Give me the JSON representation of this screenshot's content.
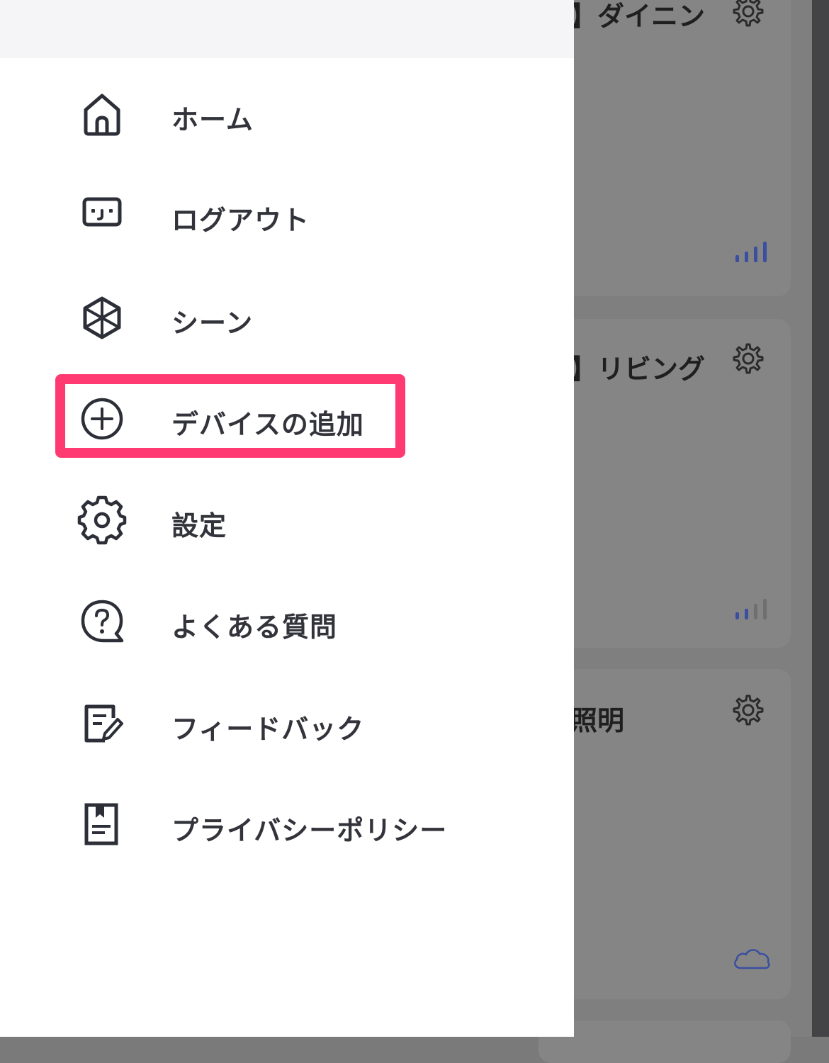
{
  "background": {
    "cards": [
      {
        "title": "】ダイニン",
        "signal": "strong"
      },
      {
        "title": "】リビング",
        "signal": "medium"
      },
      {
        "title": "照明",
        "status_icon": "cloud-icon"
      }
    ]
  },
  "drawer": {
    "menu": [
      {
        "id": "home",
        "label": "ホーム",
        "icon": "home-icon"
      },
      {
        "id": "logout",
        "label": "ログアウト",
        "icon": "logout-icon"
      },
      {
        "id": "scene",
        "label": "シーン",
        "icon": "scene-icon"
      },
      {
        "id": "add-device",
        "label": "デバイスの追加",
        "icon": "plus-circle-icon",
        "highlighted": true
      },
      {
        "id": "settings",
        "label": "設定",
        "icon": "gear-icon"
      },
      {
        "id": "faq",
        "label": "よくある質問",
        "icon": "question-bubble-icon"
      },
      {
        "id": "feedback",
        "label": "フィードバック",
        "icon": "feedback-icon"
      },
      {
        "id": "privacy",
        "label": "プライバシーポリシー",
        "icon": "privacy-document-icon"
      }
    ]
  },
  "colors": {
    "highlight": "#ff3a72",
    "icon": "#2d2f38",
    "label": "#33343b",
    "signal_active": "#3a4fa0"
  }
}
